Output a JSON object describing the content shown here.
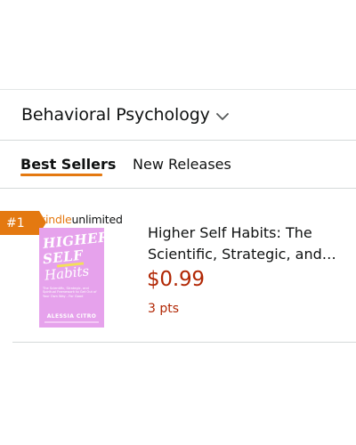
{
  "category": {
    "title": "Behavioral Psychology",
    "dropdown_icon": "chevron-down-icon"
  },
  "tabs": [
    {
      "label": "Best Sellers",
      "active": true
    },
    {
      "label": "New Releases",
      "active": false
    }
  ],
  "colors": {
    "accent": "#e47911",
    "price": "#b12704",
    "cover": "#e6a2ec"
  },
  "product": {
    "rank": "#1",
    "badge": {
      "kindle": "kindle",
      "unlimited": "unlimited"
    },
    "cover": {
      "line1": "HIGHER",
      "line2": "SELF",
      "line3": "Habits",
      "subtitle": "The Scientific, Strategic, and Spiritual Framework to Get Out of Your Own Way - For Good",
      "author": "ALESSIA CITRO"
    },
    "title": "Higher Self Habits: The Scientific, Strategic, and…",
    "price": "$0.99",
    "points": "3 pts"
  }
}
